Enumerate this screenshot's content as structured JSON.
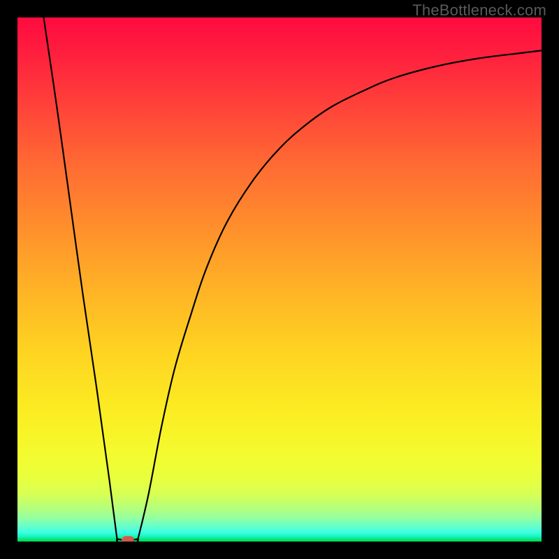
{
  "watermark": "TheBottleneck.com",
  "colors": {
    "page_bg": "#000000",
    "gradient_top": "#ff0b3e",
    "gradient_mid": "#fed421",
    "gradient_bottom": "#00d84f",
    "curve_stroke": "#000000",
    "marker_fill": "#cf5a4e",
    "watermark_text": "#5a5a5a"
  },
  "chart_data": {
    "type": "line",
    "title": "",
    "xlabel": "",
    "ylabel": "",
    "xlim": [
      0,
      100
    ],
    "ylim": [
      0,
      100
    ],
    "grid": false,
    "legend": false,
    "background": "vertical gradient red→orange→yellow→green",
    "series": [
      {
        "name": "left-descent",
        "x": [
          5,
          7.5,
          10,
          12.5,
          15,
          17.5,
          19
        ],
        "values": [
          100,
          83,
          65,
          47,
          30,
          12,
          0.5
        ]
      },
      {
        "name": "valley-floor",
        "x": [
          19,
          20,
          21,
          22,
          23
        ],
        "values": [
          0.5,
          0.3,
          0.3,
          0.3,
          0.5
        ]
      },
      {
        "name": "right-rise",
        "x": [
          23,
          25,
          27.5,
          30,
          33,
          36,
          40,
          45,
          50,
          55,
          60,
          66,
          72,
          80,
          88,
          96,
          100
        ],
        "values": [
          0.5,
          9,
          22,
          33,
          43,
          52,
          61,
          69,
          75,
          79.5,
          83,
          86,
          88.5,
          90.7,
          92.2,
          93.2,
          93.7
        ]
      }
    ],
    "marker": {
      "x": 21,
      "y": 0.3,
      "label": "optimal-point"
    },
    "interpretation": "V-shaped bottleneck curve; minimum (green zone) at roughly x≈21 on a 0–100 horizontal scale, right branch asymptotes near y≈94."
  }
}
